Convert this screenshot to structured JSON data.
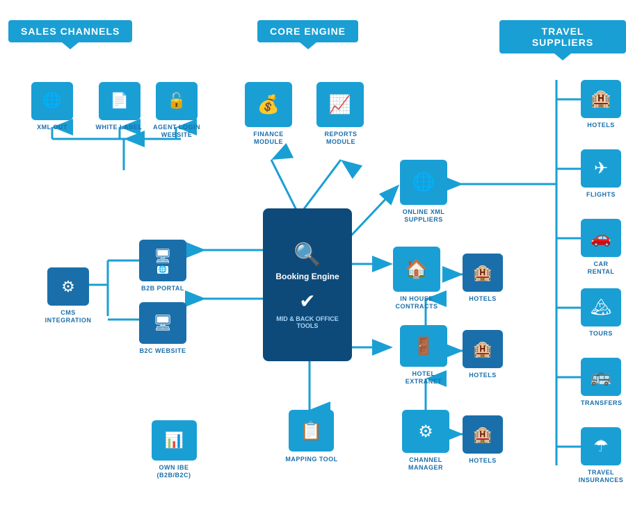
{
  "headers": {
    "sales_channels": "SALES CHANNELS",
    "core_engine": "CORE ENGINE",
    "travel_suppliers": "TRAVEL SUPPLIERS"
  },
  "sales_channel_items": [
    {
      "id": "xml-out",
      "label": "XML OUT",
      "icon": "🌐"
    },
    {
      "id": "white-label",
      "label": "WHITE LABEL",
      "icon": "📄"
    },
    {
      "id": "agent-login",
      "label": "AGENT LOGIN\nWEBSITE",
      "icon": "🔓"
    },
    {
      "id": "b2b-portal",
      "label": "B2B PORTAL",
      "icon": "🖥"
    },
    {
      "id": "b2c-website",
      "label": "B2C WEBSITE",
      "icon": "🖥"
    },
    {
      "id": "cms-integration",
      "label": "CMS\nINTEGRATION",
      "icon": "⚙"
    },
    {
      "id": "own-ibe",
      "label": "OWN IBE\n(B2B/B2C)",
      "icon": "📊"
    }
  ],
  "core_engine_items": [
    {
      "id": "finance-module",
      "label": "FINANCE MODULE",
      "icon": "💰"
    },
    {
      "id": "reports-module",
      "label": "REPORTS MODULE",
      "icon": "📈"
    },
    {
      "id": "mapping-tool",
      "label": "MAPPING TOOL",
      "icon": "📋"
    },
    {
      "id": "booking-engine",
      "label": "Booking Engine",
      "icon": "🔍"
    },
    {
      "id": "mid-back-office",
      "label": "MID & BACK OFFICE TOOLS",
      "icon": "✔"
    }
  ],
  "supplier_items": [
    {
      "id": "online-xml",
      "label": "ONLINE XML\nSUPPLIERS",
      "icon": "🌐"
    },
    {
      "id": "in-house-contracts",
      "label": "IN HOUSE\nCONTRACTS",
      "icon": "🏠"
    },
    {
      "id": "hotels-1",
      "label": "HOTELS",
      "icon": "🏨"
    },
    {
      "id": "hotel-extranet",
      "label": "HOTEL\nEXTRANET",
      "icon": "🚪"
    },
    {
      "id": "hotels-2",
      "label": "HOTELS",
      "icon": "🏨"
    },
    {
      "id": "channel-manager",
      "label": "CHANNEL\nMANAGER",
      "icon": "⚙"
    },
    {
      "id": "hotels-3",
      "label": "HOTELS",
      "icon": "🏨"
    }
  ],
  "travel_suppliers": [
    {
      "id": "hotels",
      "label": "HOTELS",
      "icon": "🏨"
    },
    {
      "id": "flights",
      "label": "FLIGHTS",
      "icon": "✈"
    },
    {
      "id": "car-rental",
      "label": "CAR RENTAL",
      "icon": "🚗"
    },
    {
      "id": "tours",
      "label": "TOURS",
      "icon": "🏔"
    },
    {
      "id": "transfers",
      "label": "TRANSFERS",
      "icon": "🚌"
    },
    {
      "id": "travel-insurances",
      "label": "TRAVEL\nINSURANCES",
      "icon": "☂"
    }
  ]
}
